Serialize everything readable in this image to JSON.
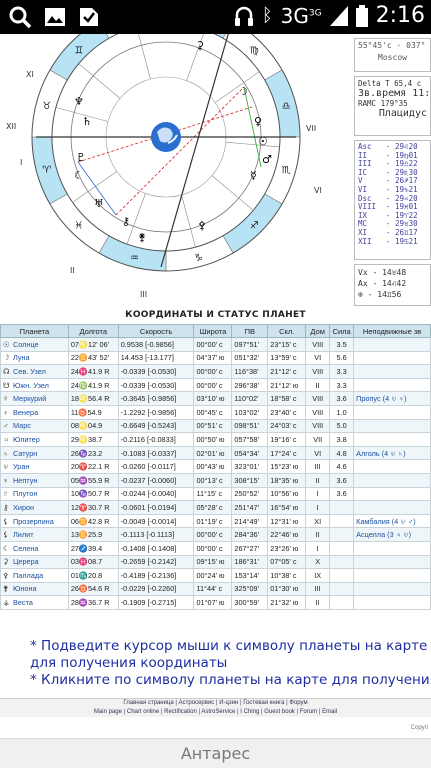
{
  "status_bar": {
    "network": "3G",
    "network_sup": "3G",
    "time": "2:16"
  },
  "chart_panel": {
    "coords": "55°45'с · 037°",
    "city": "Moscow",
    "delta_t": "Delta T   65,4 с",
    "zv_time_label": "Зв.время",
    "zv_time": "11:",
    "ramc": "RAMC 179°35",
    "house_system": "Плацидус",
    "houses": [
      {
        "label": "Asc",
        "value": "29♌20"
      },
      {
        "label": "II",
        "value": "19♍01"
      },
      {
        "label": "III",
        "value": "19♎22"
      },
      {
        "label": "IC",
        "value": "29♏30"
      },
      {
        "label": "V",
        "value": "26♐17"
      },
      {
        "label": "VI",
        "value": "19♑21"
      },
      {
        "label": "Dsc",
        "value": "29♒20"
      },
      {
        "label": "VIII",
        "value": "19♓01"
      },
      {
        "label": "IX",
        "value": "19♈22"
      },
      {
        "label": "MC",
        "value": "29♉30"
      },
      {
        "label": "XI",
        "value": "26♊17"
      },
      {
        "label": "XII",
        "value": "19♋21"
      }
    ],
    "aspects_extra": [
      "Vx  -  14♉48",
      "Ax  -  14♌42",
      "⊕   -  14♊56"
    ]
  },
  "wheel": {
    "house_numerals": [
      "I",
      "II",
      "III",
      "IV",
      "V",
      "VI",
      "VII",
      "VIII",
      "IX",
      "X",
      "XI",
      "XII"
    ]
  },
  "table": {
    "title": "КООРДИНАТЫ  И  СТАТУС  ПЛАНЕТ",
    "headers": [
      "Планета",
      "Долгота",
      "Скорость",
      "Широта",
      "ПВ",
      "Скл.",
      "Дом",
      "Сила",
      "Неподвижные зв"
    ],
    "rows": [
      {
        "glyph": "☉",
        "name": "Солнце",
        "lon": "07♌12' 06'",
        "speed": "0.9538  [-0.9856]",
        "lat": "00°00' c",
        "pv": "097°51'",
        "decl": "23°15' c",
        "house": "VIII",
        "power": "3.5",
        "star": ""
      },
      {
        "glyph": "☽",
        "name": "Луна",
        "lon": "22♊43' 52'",
        "speed": "14.453  [-13.177]",
        "lat": "04°37' ю",
        "pv": "051°32'",
        "decl": "13°59' c",
        "house": "VI",
        "power": "5.6",
        "star": ""
      },
      {
        "glyph": "☊",
        "name": "Сев. Узел",
        "lon": "24♓41.9  R",
        "speed": "-0.0339  [-0.0530]",
        "lat": "00°00' c",
        "pv": "116°38'",
        "decl": "21°12' c",
        "house": "VIII",
        "power": "3.3",
        "star": ""
      },
      {
        "glyph": "☋",
        "name": "Южн. Узел",
        "lon": "24♍41.9  R",
        "speed": "-0.0339  [-0.0530]",
        "lat": "00°00' c",
        "pv": "296°38'",
        "decl": "21°12' ю",
        "house": "II",
        "power": "3.3",
        "star": ""
      },
      {
        "glyph": "☿",
        "name": "Меркурий",
        "lon": "18♌56.4  R",
        "speed": "-0.3645  [-0.9856]",
        "lat": "03°10' ю",
        "pv": "110°02'",
        "decl": "18°58' c",
        "house": "VIII",
        "power": "3.6",
        "star": "Пропус (4 ♅ ♀)"
      },
      {
        "glyph": "♀",
        "name": "Венера",
        "lon": "11♉54.9",
        "speed": "-1.2292  [-0.9856]",
        "lat": "00°45' c",
        "pv": "103°02'",
        "decl": "23°40' c",
        "house": "VIII",
        "power": "1.0",
        "star": ""
      },
      {
        "glyph": "♂",
        "name": "Марс",
        "lon": "08♌04.9",
        "speed": "-0.6649  [-0.5243]",
        "lat": "00°51' c",
        "pv": "098°51'",
        "decl": "24°03' c",
        "house": "VIII",
        "power": "5.0",
        "star": ""
      },
      {
        "glyph": "♃",
        "name": "Юпитер",
        "lon": "29♌38.7",
        "speed": "-0.2116  [-0.0833]",
        "lat": "00°50' ю",
        "pv": "057°58'",
        "decl": "19°16' c",
        "house": "VII",
        "power": "3.8",
        "star": ""
      },
      {
        "glyph": "♄",
        "name": "Сатурн",
        "lon": "26♑23.2",
        "speed": "-0.1083  [-0.0337]",
        "lat": "02°01' ю",
        "pv": "054°34'",
        "decl": "17°24' c",
        "house": "VI",
        "power": "4.8",
        "star": "Алголь (4 ♅ ♄)"
      },
      {
        "glyph": "♅",
        "name": "Уран",
        "lon": "20♈22.1  R",
        "speed": "-0.0260  [-0.0117]",
        "lat": "00°43' ю",
        "pv": "323°01'",
        "decl": "15°23' ю",
        "house": "III",
        "power": "4.6",
        "star": ""
      },
      {
        "glyph": "♆",
        "name": "Нептун",
        "lon": "05♒55.9  R",
        "speed": "-0.0237  [-0.0060]",
        "lat": "00°13' c",
        "pv": "308°15'",
        "decl": "18°35' ю",
        "house": "II",
        "power": "3.6",
        "star": ""
      },
      {
        "glyph": "♇",
        "name": "Плутон",
        "lon": "10♑50.7  R",
        "speed": "-0.0244  [-0.0040]",
        "lat": "11°15' c",
        "pv": "250°52'",
        "decl": "10°56' ю",
        "house": "I",
        "power": "3.6",
        "star": ""
      },
      {
        "glyph": "⚷",
        "name": "Хирон",
        "lon": "12♈30.7  R",
        "speed": "-0.0601  [-0.0194]",
        "lat": "05°28' c",
        "pv": "251°47'",
        "decl": "16°54' ю",
        "house": "I",
        "power": "",
        "star": ""
      },
      {
        "glyph": "⚸",
        "name": "Прозерпина",
        "lon": "06♊42.8  R",
        "speed": "-0.0049  [-0.0014]",
        "lat": "01°19' c",
        "pv": "214°49'",
        "decl": "12°31' ю",
        "house": "XI",
        "power": "",
        "star": "Камбалия (4 ♅ ♂)"
      },
      {
        "glyph": "⚸",
        "name": "Лилит",
        "lon": "13♊25.9",
        "speed": "-0.1113  [-0.1113]",
        "lat": "00°00' c",
        "pv": "284°36'",
        "decl": "22°46' ю",
        "house": "II",
        "power": "",
        "star": "Асцелла (3 ♃ ♅)"
      },
      {
        "glyph": "☾",
        "name": "Селена",
        "lon": "27♐39.4",
        "speed": "-0.1408  [-0.1408]",
        "lat": "00°00' c",
        "pv": "267°27'",
        "decl": "23°26' ю",
        "house": "I",
        "power": "",
        "star": ""
      },
      {
        "glyph": "⚳",
        "name": "Церера",
        "lon": "03♓08.7",
        "speed": "-0.2659  [-0.2142]",
        "lat": "09°15' ю",
        "pv": "186°31'",
        "decl": "07°05' c",
        "house": "X",
        "power": "",
        "star": ""
      },
      {
        "glyph": "⚴",
        "name": "Паллада",
        "lon": "01♏20.8",
        "speed": "-0.4189  [-0.2136]",
        "lat": "00°24' ю",
        "pv": "153°14'",
        "decl": "10°38' c",
        "house": "IX",
        "power": "",
        "star": ""
      },
      {
        "glyph": "⚵",
        "name": "Юнона",
        "lon": "26♉54.6  R",
        "speed": "-0.0229  [-0.2260]",
        "lat": "11°44' c",
        "pv": "325°09'",
        "decl": "01°30' ю",
        "house": "III",
        "power": "",
        "star": ""
      },
      {
        "glyph": "⚶",
        "name": "Веста",
        "lon": "28♒36.7  R",
        "speed": "-0.1909  [-0.2715]",
        "lat": "01°07' ю",
        "pv": "300°59'",
        "decl": "21°32' ю",
        "house": "II",
        "power": "",
        "star": ""
      }
    ]
  },
  "hints": {
    "line1": "* Подведите курсор мыши к символу планеты на карте",
    "line2": "для получения координаты",
    "line3": "* Кликните по символу планеты на карте для получения"
  },
  "footer": {
    "row1": [
      "Главная страница",
      "Астросервис",
      "И-цзин",
      "Гостевая книга",
      "Форум"
    ],
    "row2": [
      "Main page",
      "Chart online",
      "Rectification",
      "AstroService",
      "I Ching",
      "Guest book",
      "Forum",
      "Email"
    ],
    "copyright": "Copyri"
  },
  "bottom_bar": {
    "title": "Антарес"
  },
  "colors": {
    "zodiac_sign_wheel": "#b7e3f5",
    "zodiac_alt": "#ffffff",
    "earth_blue": "#2a6fd0",
    "aspect_red": "#d22",
    "link_blue": "#1a50a0"
  }
}
